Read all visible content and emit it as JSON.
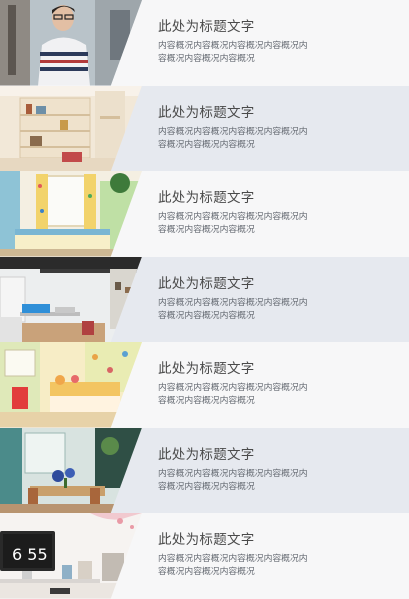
{
  "items": [
    {
      "title": "此处为标题文字",
      "desc": "内容概况内容概况内容概况内容概况内容概况内容概况内容概况",
      "image": "person-portrait"
    },
    {
      "title": "此处为标题文字",
      "desc": "内容概况内容概况内容概况内容概况内容概况内容概况内容概况",
      "image": "shelf-room"
    },
    {
      "title": "此处为标题文字",
      "desc": "内容概况内容概况内容概况内容概况内容概况内容概况内容概况",
      "image": "kids-bedroom"
    },
    {
      "title": "此处为标题文字",
      "desc": "内容概况内容概况内容概况内容概况内容概况内容概况内容概况",
      "image": "study-loft"
    },
    {
      "title": "此处为标题文字",
      "desc": "内容概况内容概况内容概况内容概况内容概况内容概况内容概况",
      "image": "yellow-bedroom"
    },
    {
      "title": "此处为标题文字",
      "desc": "内容概况内容概况内容概况内容概况内容概况内容概况内容概况",
      "image": "dining-room"
    },
    {
      "title": "此处为标题文字",
      "desc": "内容概况内容概况内容概况内容概况内容概况内容概况内容概况",
      "image": "desk-clock"
    }
  ],
  "clock": {
    "text": "6 55"
  }
}
